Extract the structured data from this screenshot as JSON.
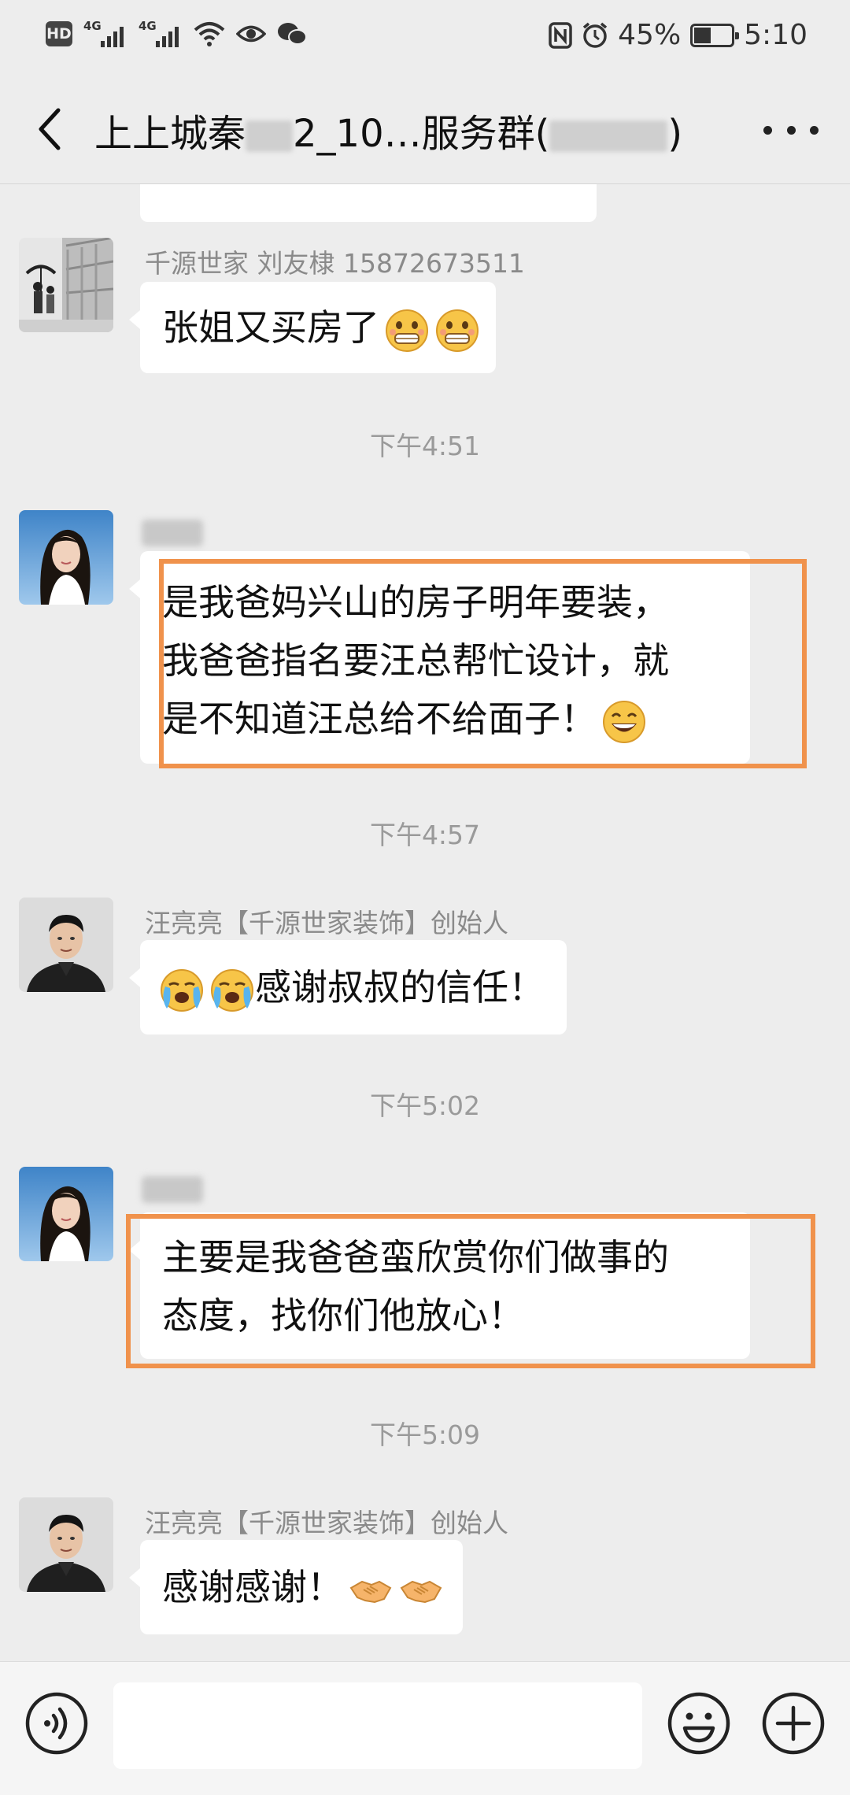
{
  "status_bar": {
    "network_badge": "HD",
    "sim1_network": "4G",
    "sim2_network": "4G",
    "battery_percent": "45%",
    "battery_level": 0.45,
    "time": "5:10",
    "icons": [
      "hd-icon",
      "signal-icon",
      "signal-icon",
      "wifi-icon",
      "eye-icon",
      "wechat-icon",
      "nfc-icon",
      "alarm-icon",
      "battery-icon"
    ]
  },
  "nav": {
    "title_prefix": "上上城秦",
    "title_mid": "2_10…服务群(",
    "title_suffix": ")",
    "back_icon": "back-chevron-icon",
    "more_icon": "more-dots-icon"
  },
  "messages": [
    {
      "sender": "千源世家   刘友棣 15872673511",
      "text": "张姐又买房了",
      "emojis": [
        "grimace-emoji",
        "grimace-emoji"
      ]
    },
    {
      "time": "下午4:51",
      "sender": "",
      "lines": [
        "是我爸妈兴山的房子明年要装，",
        "我爸爸指名要汪总帮忙设计，就",
        "是不知道汪总给不给面子！"
      ],
      "emojis": [
        "grin-emoji"
      ],
      "highlighted": true
    },
    {
      "time": "下午4:57",
      "sender": "汪亮亮【千源世家装饰】创始人",
      "text": "感谢叔叔的信任！",
      "emojis": [
        "loudly-crying-emoji",
        "loudly-crying-emoji"
      ]
    },
    {
      "time": "下午5:02",
      "sender": "",
      "lines": [
        "主要是我爸爸蛮欣赏你们做事的",
        "态度，找你们他放心！"
      ],
      "highlighted": true
    },
    {
      "time": "下午5:09",
      "sender": "汪亮亮【千源世家装饰】创始人",
      "text": "感谢感谢！",
      "emojis": [
        "handshake-emoji",
        "handshake-emoji"
      ]
    }
  ],
  "input_bar": {
    "placeholder": "",
    "icons": [
      "voice-icon",
      "emoji-icon",
      "add-icon"
    ]
  },
  "colors": {
    "background": "#ededed",
    "bubble": "#ffffff",
    "highlight": "#f0924c",
    "meta_text": "#8a8a8a"
  }
}
